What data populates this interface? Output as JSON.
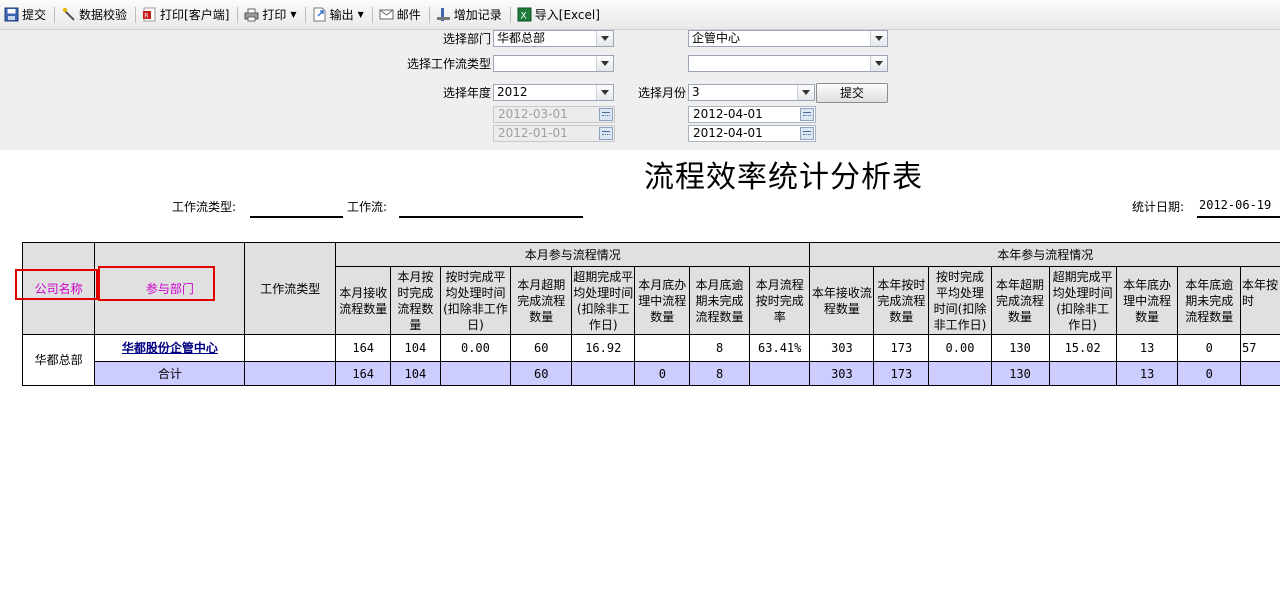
{
  "toolbar": {
    "submit": "提交",
    "validate": "数据校验",
    "print_client": "打印[客户端]",
    "print": "打印",
    "export": "输出",
    "mail": "邮件",
    "add_record": "增加记录",
    "import": "导入[Excel]"
  },
  "filter": {
    "dept_label": "选择部门",
    "dept_value": "华都总部",
    "dept2_value": "企管中心",
    "wftype_label": "选择工作流类型",
    "wftype_value": "",
    "wftype2_value": "",
    "year_label": "选择年度",
    "year_value": "2012",
    "month_label": "选择月份",
    "month_value": "3",
    "submit_label": "提交",
    "date1": "2012-03-01",
    "date2": "2012-04-01",
    "date3": "2012-01-01",
    "date4": "2012-04-01"
  },
  "report": {
    "title": "流程效率统计分析表",
    "wftype_label": "工作流类型:",
    "wf_label": "工作流:",
    "stat_date_label": "统计日期:",
    "stat_date_value": "2012-06-19 1"
  },
  "table": {
    "h_company": "公司名称",
    "h_dept": "参与部门",
    "h_wftype": "工作流类型",
    "h_month_group": "本月参与流程情况",
    "h_year_group": "本年参与流程情况",
    "month_cols": [
      "本月接收流程数量",
      "本月按时完成流程数量",
      "按时完成平均处理时间(扣除非工作日)",
      "本月超期完成流程数量",
      "超期完成平均处理时间(扣除非工作日)",
      "本月底办理中流程数量",
      "本月底逾期未完成流程数量",
      "本月流程按时完成率"
    ],
    "year_cols": [
      "本年接收流程数量",
      "本年按时完成流程数量",
      "按时完成平均处理时间(扣除非工作日)",
      "本年超期完成流程数量",
      "超期完成平均处理时间(扣除非工作日)",
      "本年底办理中流程数量",
      "本年底逾期未完成流程数量",
      "本年按时"
    ],
    "row": {
      "company": "华都总部",
      "dept": "华都股份企管中心",
      "wftype": "",
      "month": [
        "164",
        "104",
        "0.00",
        "60",
        "16.92",
        "",
        "8",
        "63.41%"
      ],
      "year": [
        "303",
        "173",
        "0.00",
        "130",
        "15.02",
        "13",
        "0",
        "57"
      ]
    },
    "total": {
      "label": "合计",
      "wftype": "",
      "month": [
        "164",
        "104",
        "",
        "60",
        "",
        "0",
        "8",
        ""
      ],
      "year": [
        "303",
        "173",
        "",
        "130",
        "",
        "13",
        "0",
        ""
      ]
    }
  },
  "colors": {
    "highlight": "#cc00cc",
    "annotation_box": "#e00000",
    "total_row": "#ccccff",
    "header": "#e0e0e0"
  }
}
